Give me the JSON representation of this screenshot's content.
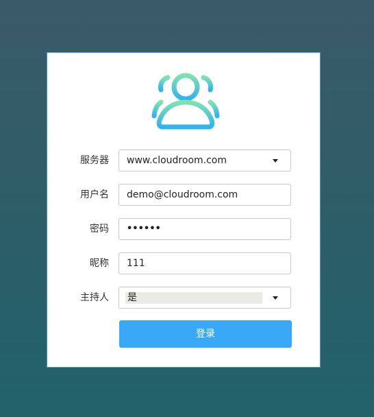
{
  "form": {
    "server": {
      "label": "服务器",
      "value": "www.cloudroom.com"
    },
    "username": {
      "label": "用户名",
      "value": "demo@cloudroom.com"
    },
    "password": {
      "label": "密码",
      "masked_value": "••••••"
    },
    "nickname": {
      "label": "昵称",
      "value": "111"
    },
    "host": {
      "label": "主持人",
      "value": "是"
    },
    "login_label": "登录"
  },
  "colors": {
    "accent": "#3aa9f5",
    "card_border": "#3a9ad9",
    "logo_gradient_top": "#7ee3b0",
    "logo_gradient_bottom": "#32b3ee"
  },
  "icons": {
    "logo": "users-group-icon",
    "dropdown": "caret-down-icon"
  }
}
